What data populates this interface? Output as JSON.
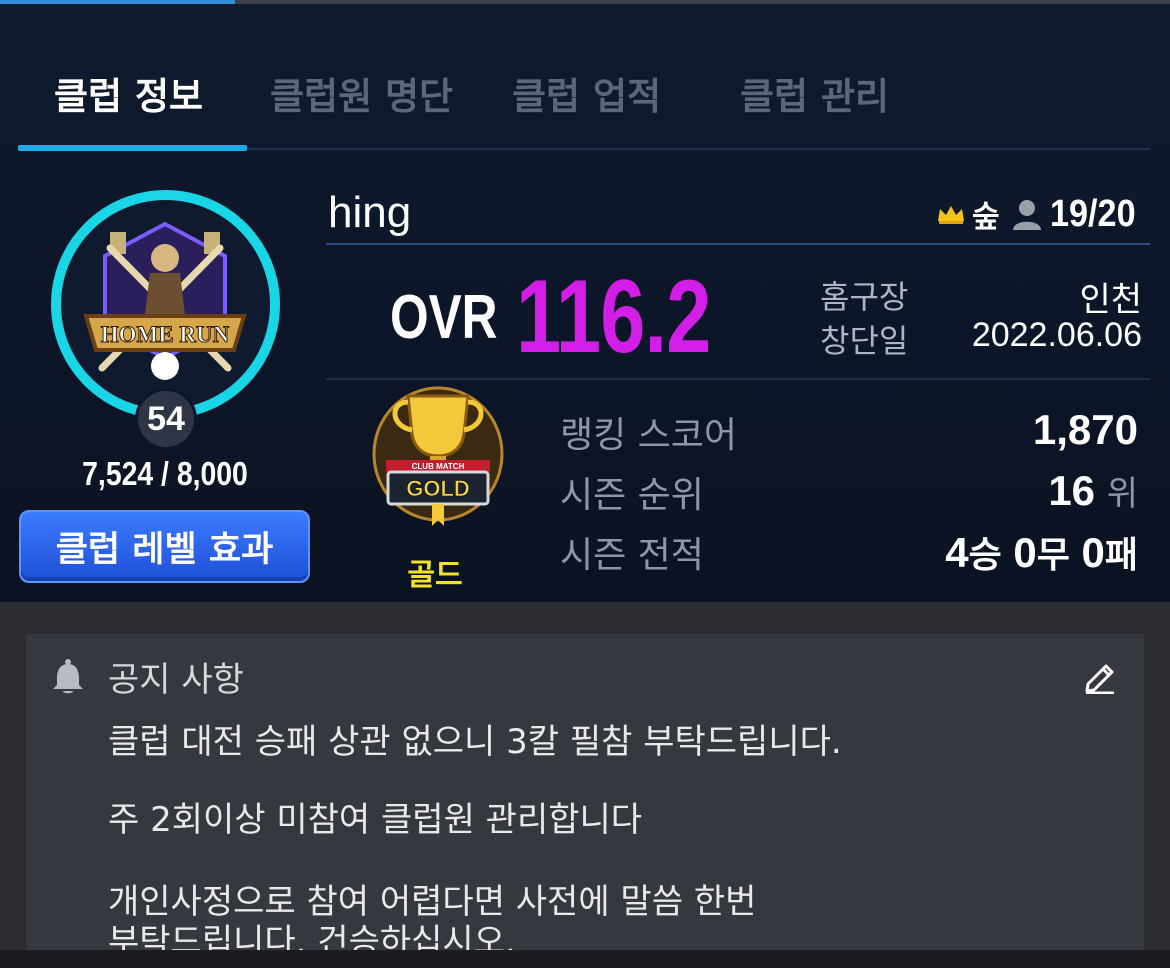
{
  "tabs": [
    {
      "label": "클럽 정보",
      "active": true
    },
    {
      "label": "클럽원 명단",
      "active": false
    },
    {
      "label": "클럽 업적",
      "active": false
    },
    {
      "label": "클럽 관리",
      "active": false
    }
  ],
  "club": {
    "name": "hing",
    "owner": "숲",
    "members": "19/20",
    "level": "54",
    "exp": "7,524 / 8,000",
    "level_effect_button": "클럽 레벨 효과",
    "emblem_text": "HOME RUN"
  },
  "ovr": {
    "label": "OVR",
    "value": "116.2"
  },
  "info": {
    "home_label": "홈구장",
    "home_value": "인천",
    "founded_label": "창단일",
    "founded_value": "2022.06.06"
  },
  "league": {
    "name": "골드",
    "badge_text": "GOLD",
    "badge_subtext": "CLUB MATCH"
  },
  "stats": {
    "ranking_label": "랭킹 스코어",
    "ranking_value": "1,870",
    "season_rank_label": "시즌 순위",
    "season_rank_value": "16",
    "season_rank_unit": "위",
    "season_record_label": "시즌 전적",
    "wins": "4",
    "wins_unit": "승",
    "draws": "0",
    "draws_unit": "무",
    "losses": "0",
    "losses_unit": "패"
  },
  "notice": {
    "title": "공지 사항",
    "lines": [
      "클럽 대전 승패 상관 없으니 3칼 필참 부탁드립니다.",
      "주 2회이상 미참여 클럽원 관리합니다",
      "개인사정으로 참여 어렵다면 사전에 말씀 한번",
      "부탁드립니다. 건승하십시오."
    ]
  },
  "colors": {
    "accent": "#22a9e8",
    "ovr": "#d21ee6",
    "league": "#f4e22a",
    "button": "#2a62e8",
    "ring": "#19d6e6"
  },
  "icons": [
    "crown-icon",
    "member-icon",
    "bell-icon",
    "edit-icon",
    "trophy-icon"
  ]
}
